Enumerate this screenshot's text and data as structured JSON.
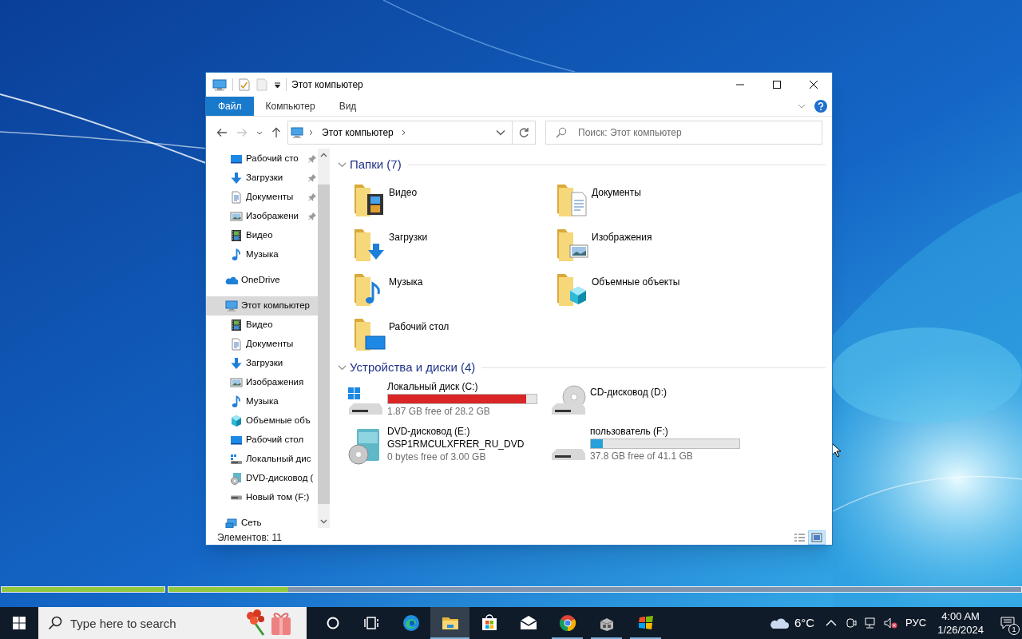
{
  "desktop_progress": [
    {
      "level": 1
    },
    {
      "level": 0.14
    }
  ],
  "window": {
    "title": "Этот компьютер"
  },
  "ribbon": {
    "tabs": [
      {
        "label": "Файл",
        "kind": "file"
      },
      {
        "label": "Компьютер",
        "kind": "tab"
      },
      {
        "label": "Вид",
        "kind": "tab"
      }
    ]
  },
  "nav_buttons": [
    {
      "kind": "back",
      "disabled": false
    },
    {
      "kind": "forward",
      "disabled": true
    },
    {
      "kind": "recent",
      "disabled": false
    },
    {
      "kind": "up",
      "disabled": false
    }
  ],
  "address": {
    "crumbs": [
      "Этот компьютер"
    ]
  },
  "search": {
    "placeholder": "Поиск: Этот компьютер"
  },
  "sidebar": {
    "quick_access": [
      {
        "label": "Рабочий сто",
        "kind": "desktop",
        "pinned": true,
        "selected": false
      },
      {
        "label": "Загрузки",
        "kind": "downloads",
        "pinned": true,
        "selected": false
      },
      {
        "label": "Документы",
        "kind": "documents",
        "pinned": true,
        "selected": false
      },
      {
        "label": "Изображени",
        "kind": "pictures",
        "pinned": true,
        "selected": false
      },
      {
        "label": "Видео",
        "kind": "video",
        "pinned": false,
        "selected": false
      },
      {
        "label": "Музыка",
        "kind": "music",
        "pinned": false,
        "selected": false
      }
    ],
    "tree": [
      {
        "label": "OneDrive",
        "kind": "onedrive",
        "selected": false
      },
      {
        "label": "Этот компьютер",
        "kind": "pc",
        "selected": true,
        "children": [
          {
            "label": "Видео",
            "kind": "video",
            "selected": false
          },
          {
            "label": "Документы",
            "kind": "documents",
            "selected": false
          },
          {
            "label": "Загрузки",
            "kind": "downloads",
            "selected": false
          },
          {
            "label": "Изображения",
            "kind": "pictures",
            "selected": false
          },
          {
            "label": "Музыка",
            "kind": "music",
            "selected": false
          },
          {
            "label": "Объемные объ",
            "kind": "objects",
            "selected": false
          },
          {
            "label": "Рабочий стол",
            "kind": "desktop",
            "selected": false
          },
          {
            "label": "Локальный дис",
            "kind": "windows-disk",
            "selected": false
          },
          {
            "label": "DVD-дисковод (",
            "kind": "dvd",
            "selected": false
          },
          {
            "label": "Новый том (F:)",
            "kind": "disk",
            "selected": false
          }
        ]
      },
      {
        "label": "Сеть",
        "kind": "network",
        "selected": false
      }
    ]
  },
  "folders": {
    "title": "Папки (7)",
    "expanded": true,
    "items": [
      {
        "label": "Видео",
        "kind": "video"
      },
      {
        "label": "Документы",
        "kind": "documents"
      },
      {
        "label": "Загрузки",
        "kind": "downloads"
      },
      {
        "label": "Изображения",
        "kind": "pictures"
      },
      {
        "label": "Музыка",
        "kind": "music"
      },
      {
        "label": "Объемные объекты",
        "kind": "objects"
      },
      {
        "label": "Рабочий стол",
        "kind": "desktop"
      }
    ]
  },
  "drives": {
    "title": "Устройства и диски (4)",
    "expanded": true,
    "items": [
      {
        "label": "Локальный диск (C:)",
        "kind": "windows-disk",
        "bar": {
          "level": 0.93,
          "color": "#da2626"
        },
        "free": "1.87 GB free of 28.2 GB"
      },
      {
        "label": "CD-дисковод (D:)",
        "kind": "cd"
      },
      {
        "label": "DVD-дисковод (E:)",
        "kind": "dvd",
        "volume": "GSP1RMCULXFRER_RU_DVD",
        "free": "0 bytes free of 3.00 GB"
      },
      {
        "label": "пользователь (F:)",
        "kind": "disk",
        "bar": {
          "level": 0.08,
          "color": "#26a0da"
        },
        "free": "37.8 GB free of 41.1 GB"
      }
    ]
  },
  "status_bar": {
    "item_count": "Элементов: 11",
    "views": [
      {
        "kind": "details",
        "selected": false
      },
      {
        "kind": "large-icons",
        "selected": true
      }
    ]
  },
  "taskbar": {
    "search_placeholder": "Type here to search",
    "apps": [
      {
        "kind": "cortana",
        "running": false,
        "active": false
      },
      {
        "kind": "task-view",
        "running": false,
        "active": false
      },
      {
        "kind": "edge",
        "running": false,
        "active": false
      },
      {
        "kind": "explorer",
        "running": true,
        "active": true
      },
      {
        "kind": "store",
        "running": false,
        "active": false
      },
      {
        "kind": "mail",
        "running": false,
        "active": false
      },
      {
        "kind": "chrome",
        "running": true,
        "active": false
      },
      {
        "kind": "installer",
        "running": true,
        "active": false
      },
      {
        "kind": "windows-flag",
        "running": true,
        "active": false
      }
    ],
    "temperature": "6°C",
    "language": "РУС",
    "time": "4:00 AM",
    "date": "1/26/2024",
    "notifications": "1"
  }
}
